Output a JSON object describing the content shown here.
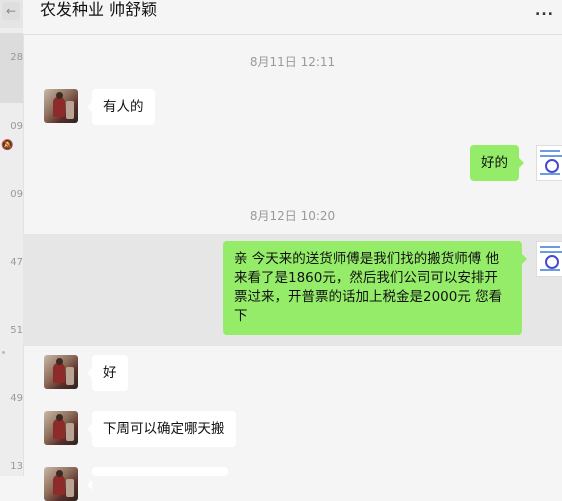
{
  "sidebar": {
    "back_glyph": "←",
    "times": [
      "28",
      "09",
      "09",
      "47",
      "51",
      "49",
      "13"
    ]
  },
  "header": {
    "title": "农发种业 帅舒颖",
    "more_glyph": "..."
  },
  "messages": {
    "ts1": "8月11日 12:11",
    "m1": "有人的",
    "m2": "好的",
    "ts2": "8月12日 10:20",
    "m3": "亲 今天来的送货师傅是我们找的搬货师傅 他来看了是1860元，然后我们公司可以安排开票过来，开普票的话加上税金是2000元 您看下",
    "m4": "好",
    "m5": "下周可以确定哪天搬"
  },
  "colors": {
    "outgoing_bubble": "#95ec69",
    "incoming_bubble": "#ffffff",
    "background": "#f5f5f5"
  }
}
